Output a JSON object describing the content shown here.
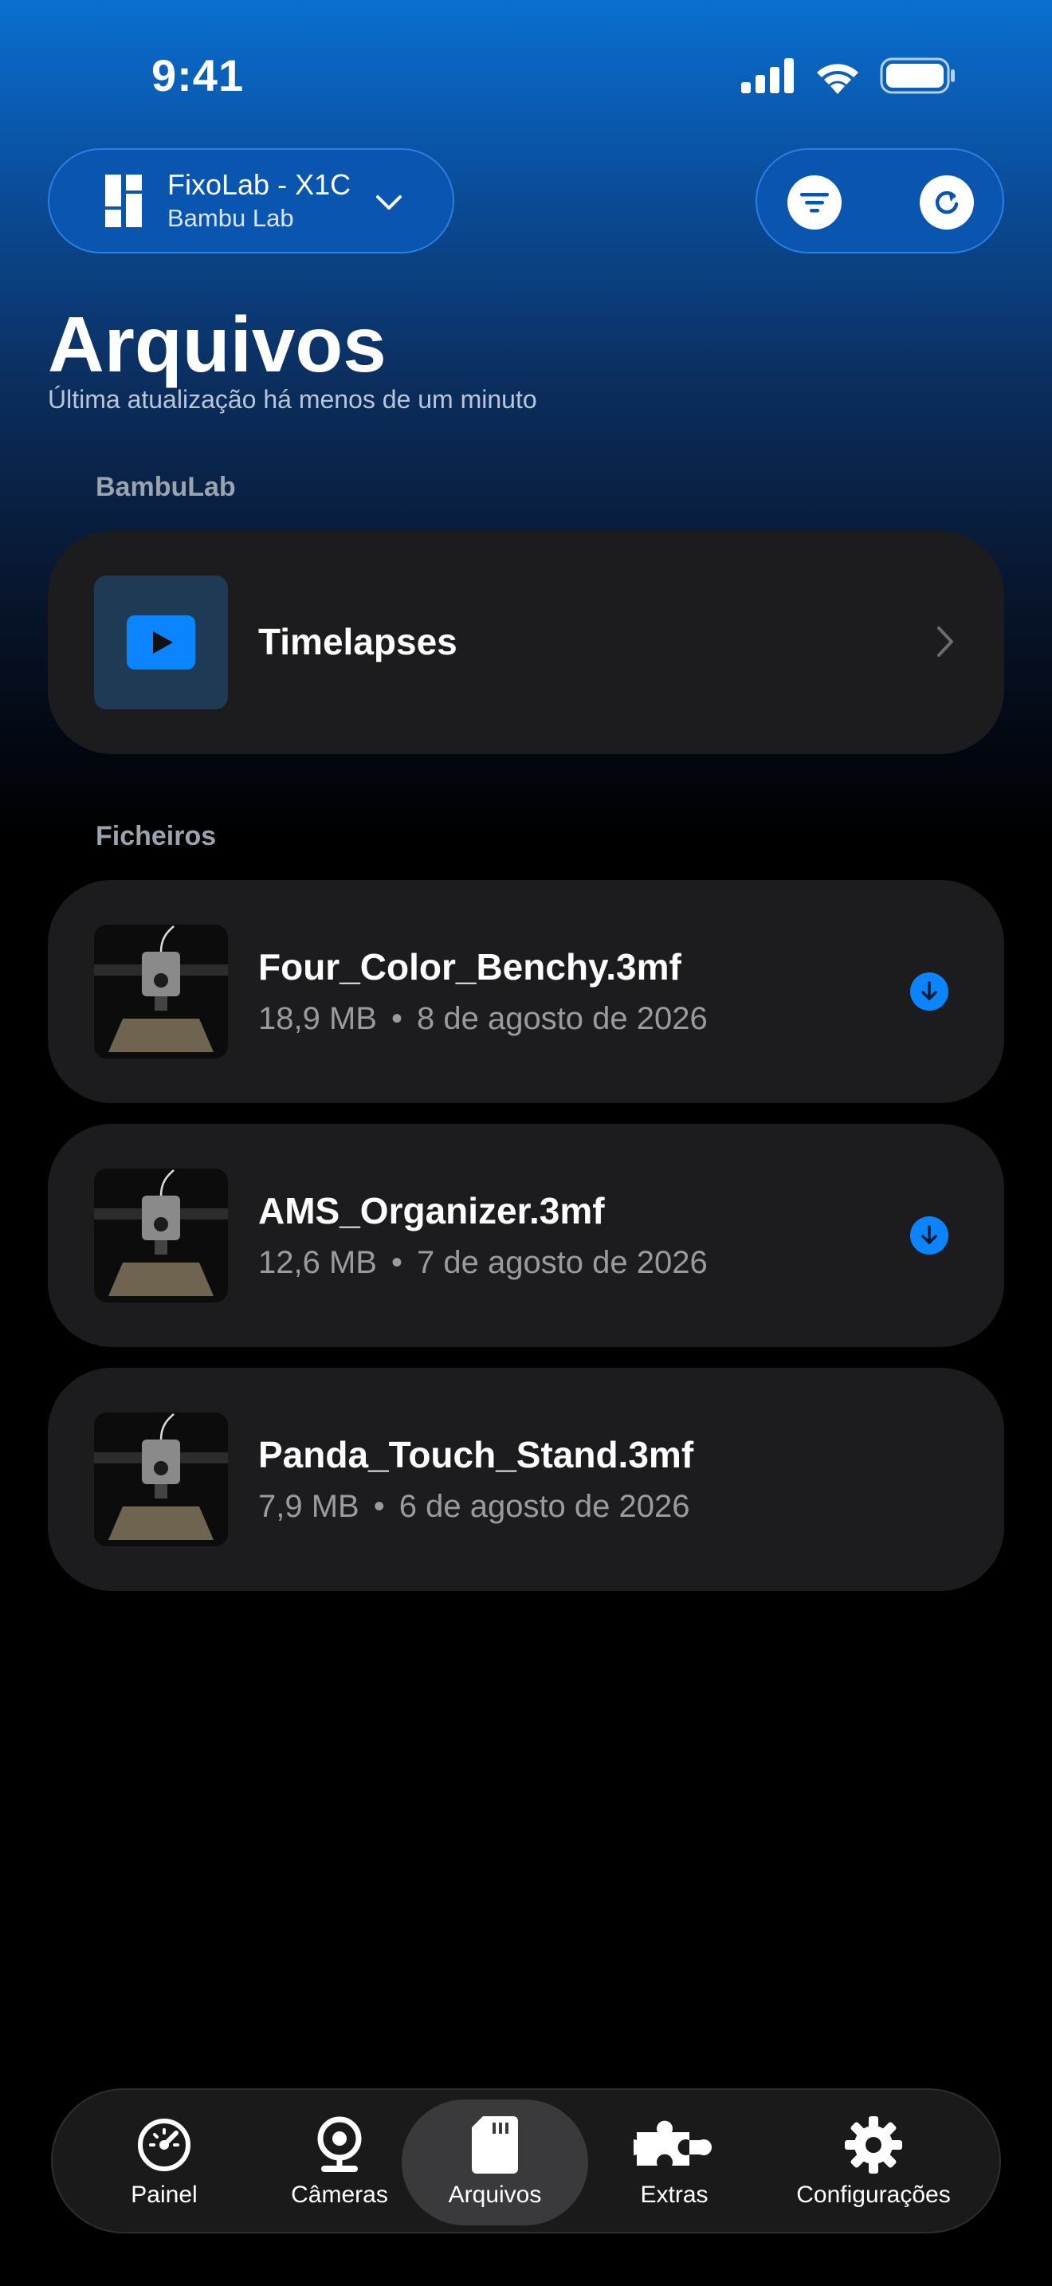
{
  "status_bar": {
    "time": "9:41"
  },
  "printer": {
    "name": "FixoLab - X1C",
    "brand": "Bambu Lab"
  },
  "header": {
    "title": "Arquivos",
    "subtitle": "Última atualização há menos de um minuto"
  },
  "sections": {
    "bambulab": {
      "label": "BambuLab",
      "item": {
        "title": "Timelapses",
        "icon": "play-icon"
      }
    },
    "files": {
      "label": "Ficheiros",
      "items": [
        {
          "name": "Four_Color_Benchy.3mf",
          "size": "18,9 MB",
          "separator": "•",
          "date": "8 de agosto de 2026",
          "downloadable": true
        },
        {
          "name": "AMS_Organizer.3mf",
          "size": "12,6 MB",
          "separator": "•",
          "date": "7 de agosto de 2026",
          "downloadable": true
        },
        {
          "name": "Panda_Touch_Stand.3mf",
          "size": "7,9 MB",
          "separator": "•",
          "date": "6 de agosto de 2026",
          "downloadable": false
        }
      ]
    }
  },
  "tabs": [
    {
      "label": "Painel",
      "icon": "gauge-icon",
      "active": false
    },
    {
      "label": "Câmeras",
      "icon": "webcam-icon",
      "active": false
    },
    {
      "label": "Arquivos",
      "icon": "sd-card-icon",
      "active": true
    },
    {
      "label": "Extras",
      "icon": "puzzle-icon",
      "active": false
    },
    {
      "label": "Configurações",
      "icon": "gear-icon",
      "active": false
    }
  ],
  "colors": {
    "accent": "#0a84ff",
    "card": "#1c1c1e"
  }
}
